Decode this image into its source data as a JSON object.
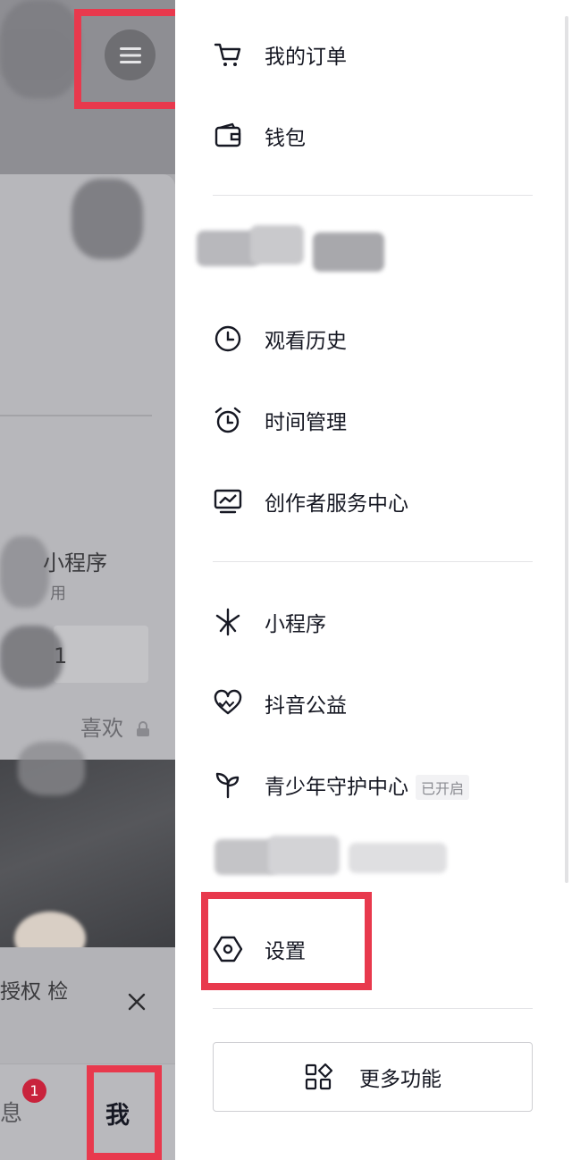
{
  "background": {
    "partial_labels": {
      "mini_program": "小程序",
      "use": "用",
      "number": "1",
      "likes": "喜欢",
      "recommend": "授权 检",
      "messages": "息",
      "me": "我"
    },
    "message_badge": "1"
  },
  "drawer": {
    "items": [
      {
        "label": "我的订单",
        "icon": "cart-icon"
      },
      {
        "label": "钱包",
        "icon": "wallet-icon"
      },
      {
        "label": "观看历史",
        "icon": "clock-icon"
      },
      {
        "label": "时间管理",
        "icon": "alarm-clock-icon"
      },
      {
        "label": "创作者服务中心",
        "icon": "monitor-chart-icon"
      },
      {
        "label": "小程序",
        "icon": "mini-program-icon"
      },
      {
        "label": "抖音公益",
        "icon": "heart-icon"
      },
      {
        "label": "青少年守护中心",
        "icon": "sprout-icon",
        "tag": "已开启"
      },
      {
        "label": "设置",
        "icon": "settings-hexagon-icon"
      }
    ],
    "more_button": {
      "label": "更多功能",
      "icon": "grid-shapes-icon"
    }
  },
  "colors": {
    "highlight": "#e8394d",
    "badge": "#c9233c",
    "text": "#161823"
  }
}
